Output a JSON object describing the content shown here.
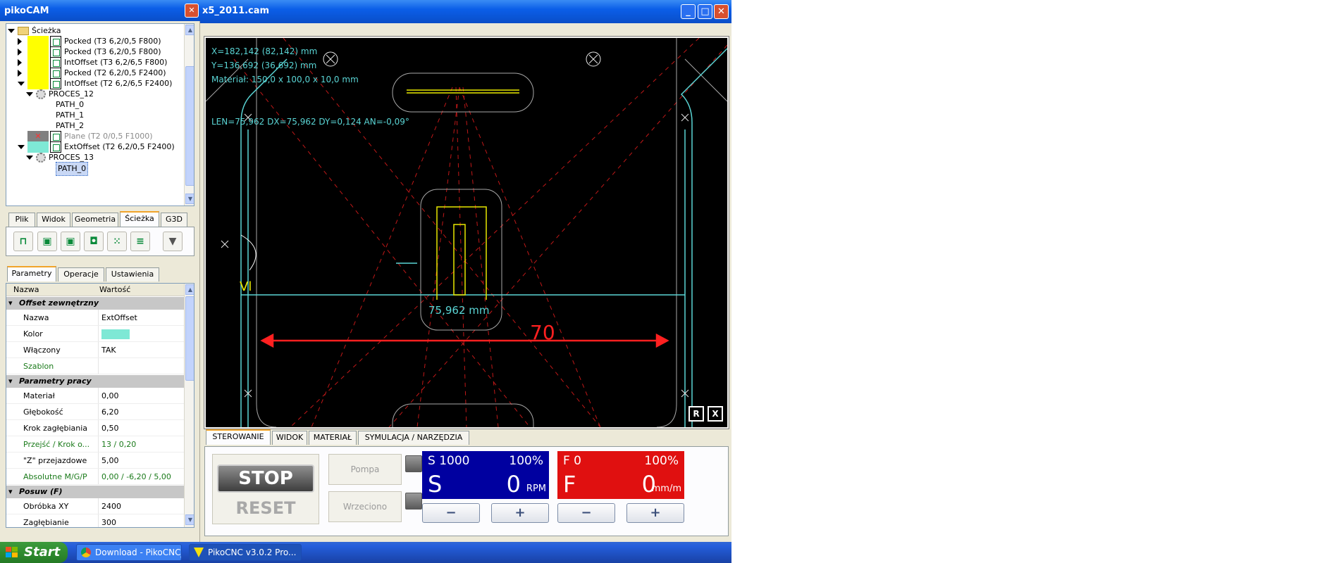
{
  "main_window": {
    "title": "x5_2011.cam",
    "buttons": {
      "minimize": "_",
      "maximize": "□",
      "close": "✕"
    }
  },
  "left_window": {
    "title": "pikoCAM",
    "close": "✕"
  },
  "tree": {
    "top_partial": "",
    "items": [
      {
        "label": "Ścieżka",
        "kind": "folder"
      },
      {
        "label": "Pocked (T3 6,2/0,5 F800)",
        "kind": "op",
        "color": "#ffff00"
      },
      {
        "label": "Pocked (T3 6,2/0,5 F800)",
        "kind": "op",
        "color": "#ffff00"
      },
      {
        "label": "IntOffset (T3 6,2/6,5 F800)",
        "kind": "op",
        "color": "#ffff00"
      },
      {
        "label": "Pocked (T2 6,2/0,5 F2400)",
        "kind": "op",
        "color": "#ffff00"
      },
      {
        "label": "IntOffset (T2 6,2/6,5 F2400)",
        "kind": "op",
        "color": "#ffff00"
      },
      {
        "label": "PROCES_12",
        "kind": "proc"
      },
      {
        "label": "PATH_0",
        "kind": "path"
      },
      {
        "label": "PATH_1",
        "kind": "path"
      },
      {
        "label": "PATH_2",
        "kind": "path"
      },
      {
        "label": "Plane (T2 0/0,5 F1000)",
        "kind": "op-disabled",
        "color": "#808080"
      },
      {
        "label": "ExtOffset (T2 6,2/0,5 F2400)",
        "kind": "op",
        "color": "#7ee8d5"
      },
      {
        "label": "PROCES_13",
        "kind": "proc"
      },
      {
        "label": "PATH_0",
        "kind": "path-selected"
      }
    ]
  },
  "main_tabs": [
    "Plik",
    "Widok",
    "Geometria",
    "Ścieżka",
    "G3D"
  ],
  "main_tab_active": "Ścieżka",
  "tools": [
    "pocket-zigzag-icon",
    "ext-offset-icon",
    "int-offset-icon",
    "pocket-icon",
    "drill-points-icon",
    "plane-icon",
    "engrave-icon"
  ],
  "prop_tabs": [
    "Parametry",
    "Operacje",
    "Ustawienia"
  ],
  "prop_header": {
    "name": "Nazwa",
    "value": "Wartość"
  },
  "prop_groups": {
    "g1": "Offset zewnętrzny",
    "g2": "Parametry pracy",
    "g3": "Posuw (F)"
  },
  "props": {
    "nazwa": {
      "name": "Nazwa",
      "value": "ExtOffset"
    },
    "kolor": {
      "name": "Kolor",
      "value": "",
      "color": "#7ee8d5"
    },
    "wlaczony": {
      "name": "Włączony",
      "value": "TAK"
    },
    "szablon": {
      "name": "Szablon",
      "value": ""
    },
    "material": {
      "name": "Materiał",
      "value": "0,00"
    },
    "glebokosc": {
      "name": "Głębokość",
      "value": "6,20"
    },
    "krok": {
      "name": "Krok zagłębiania",
      "value": "0,50"
    },
    "przejsc": {
      "name": "Przejść / Krok o...",
      "value": "13 / 0,20"
    },
    "z_przej": {
      "name": "\"Z\" przejazdowe",
      "value": "5,00"
    },
    "absolutne": {
      "name": "Absolutne M/G/P",
      "value": "0,00 / -6,20 / 5,00"
    },
    "obrobka": {
      "name": "Obróbka XY",
      "value": "2400"
    },
    "zaglebianie": {
      "name": "Zagłębianie",
      "value": "300"
    }
  },
  "canvas": {
    "coord_x": "X=182,142 (82,142) mm",
    "coord_y": "Y=136,692 (36,692) mm",
    "material": "Materiał: 150,0 x 100,0 x 10,0 mm",
    "measure": "LEN=75,962 DX=75,962 DY=0,124 AN=-0,09°",
    "dim_label": "75,962 mm",
    "red_label": "70",
    "vl_label": "Vl",
    "btn_r": "R",
    "btn_x": "X"
  },
  "ctrl_tabs": [
    "STEROWANIE",
    "WIDOK",
    "MATERIAŁ",
    "SYMULACJA / NARZĘDZIA"
  ],
  "ctrl_tab_active": "STEROWANIE",
  "control": {
    "stop": "STOP",
    "reset": "RESET",
    "pompa": "Pompa",
    "wrzeciono": "Wrzeciono",
    "spindle": {
      "top_left": "S 1000",
      "top_right": "100%",
      "letter": "S",
      "value": "0",
      "unit": "RPM",
      "color": "#0000a0"
    },
    "feed": {
      "top_left": "F 0",
      "top_right": "100%",
      "letter": "F",
      "value": "0",
      "unit": "mm/m",
      "color": "#e01010"
    },
    "minus": "−",
    "plus": "+"
  },
  "taskbar": {
    "start": "Start",
    "items": [
      {
        "label": "Download - PikoCNC_...",
        "icon": "chrome-icon"
      },
      {
        "label": "PikoCNC v3.0.2    Pro...",
        "icon": "pikocnc-icon"
      }
    ]
  }
}
